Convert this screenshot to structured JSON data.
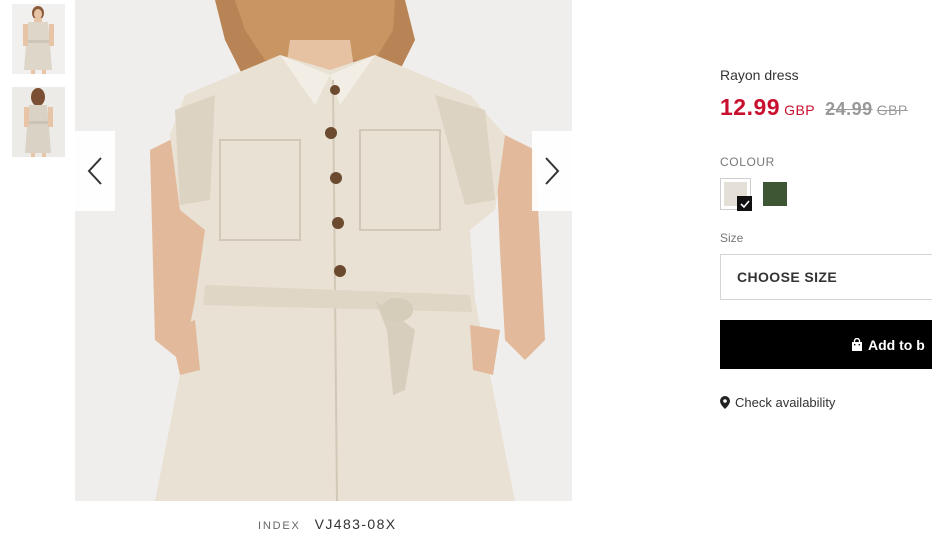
{
  "product": {
    "title": "Rayon dress",
    "price_new": "12.99",
    "currency_new": "GBP",
    "price_old": "24.99",
    "currency_old": "GBP",
    "index_label": "INDEX",
    "index_value": "VJ483-08X"
  },
  "colour": {
    "label": "COLOUR",
    "swatches": [
      {
        "name": "beige",
        "color": "#e4e0d8",
        "selected": true
      },
      {
        "name": "khaki",
        "color": "#3f5634",
        "selected": false
      }
    ]
  },
  "size": {
    "label": "Size",
    "select_value": "CHOOSE SIZE"
  },
  "actions": {
    "add_to_bag": "Add to b",
    "check_availability": "Check availability"
  },
  "gallery": {
    "thumbnails": [
      "front-view",
      "back-view"
    ],
    "icons": [
      "chevron-left-icon",
      "chevron-right-icon",
      "checkmark-icon",
      "shopping-bag-icon",
      "map-pin-icon"
    ]
  },
  "colors": {
    "sale_red": "#c8102e",
    "button_black": "#000000",
    "muted_grey": "#999999"
  }
}
